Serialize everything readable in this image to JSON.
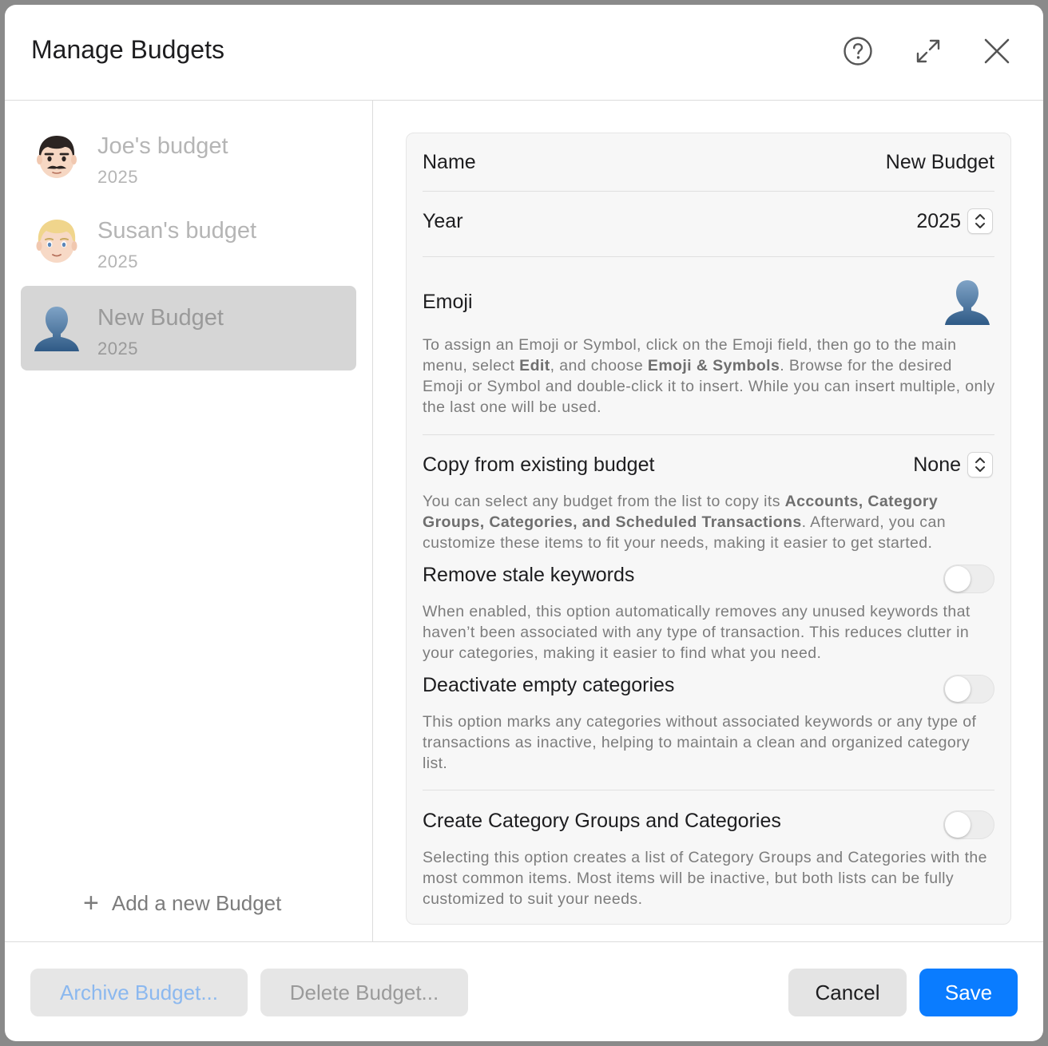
{
  "window": {
    "title": "Manage Budgets"
  },
  "header_icons": [
    "help-icon",
    "expand-icon",
    "close-icon"
  ],
  "sidebar": {
    "items": [
      {
        "name": "Joe's budget",
        "year": "2025",
        "avatar": "man-mustache-emoji",
        "selected": false
      },
      {
        "name": "Susan's budget",
        "year": "2025",
        "avatar": "blond-person-emoji",
        "selected": false
      },
      {
        "name": "New Budget",
        "year": "2025",
        "avatar": "bust-silhouette-emoji",
        "selected": true
      }
    ],
    "add_label": "Add a new Budget"
  },
  "form": {
    "name_label": "Name",
    "name_value": "New Budget",
    "year_label": "Year",
    "year_value": "2025",
    "emoji_label": "Emoji",
    "emoji_value": "bust-silhouette-emoji",
    "emoji_desc": {
      "p1": "To assign an Emoji or Symbol, click on the Emoji field, then go to the main menu, select ",
      "b1": "Edit",
      "p2": ", and choose ",
      "b2": "Emoji & Symbols",
      "p3": ". Browse for the desired Emoji or Symbol and double-click it to insert. While you can insert multiple, only the last one will be used."
    },
    "copy_label": "Copy from existing budget",
    "copy_value": "None",
    "copy_desc": {
      "p1": "You can select any budget from the list to copy its ",
      "b1": "Accounts, Category Groups, Categories, and Scheduled Transactions",
      "p2": ". Afterward, you can customize these items to fit your needs, making it easier to get started."
    },
    "stale_label": "Remove stale keywords",
    "stale_desc": "When enabled, this option automatically removes any unused keywords that haven’t been associated with any type of transaction. This reduces clutter in your categories, making it easier to find what you need.",
    "stale_enabled": false,
    "deactivate_label": "Deactivate empty categories",
    "deactivate_desc": "This option marks any categories without associated keywords or any type of transactions as inactive, helping to maintain a clean and organized category list.",
    "deactivate_enabled": false,
    "create_label": "Create Category Groups and Categories",
    "create_desc": "Selecting this option creates a list of Category Groups and Categories with the most common items. Most items will be inactive, but both lists can be fully customized to suit your needs.",
    "create_enabled": false
  },
  "footer": {
    "archive_label": "Archive Budget...",
    "delete_label": "Delete Budget...",
    "cancel_label": "Cancel",
    "save_label": "Save"
  },
  "colors": {
    "accent": "#0a7cff",
    "selected_row": "#d6d6d6",
    "archive_text": "#8bb8ef"
  }
}
